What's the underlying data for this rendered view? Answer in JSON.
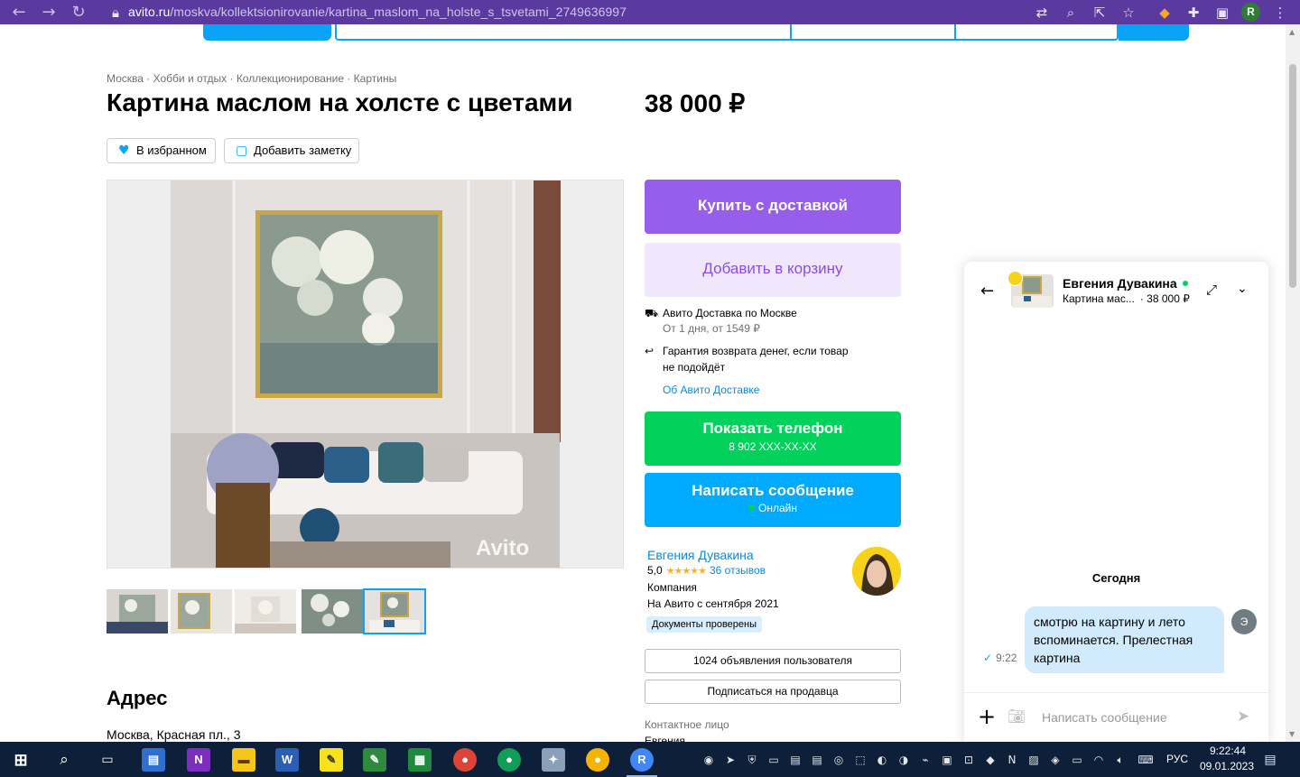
{
  "browser": {
    "url_host": "avito.ru",
    "url_path": "/moskva/kollektsionirovanie/kartina_maslom_na_holste_s_tsvetami_2749636997",
    "profile_initial": "R"
  },
  "breadcrumbs": [
    "Москва",
    "Хобби и отдых",
    "Коллекционирование",
    "Картины"
  ],
  "listing": {
    "title": "Картина маслом на холсте с цветами",
    "price": "38 000 ₽",
    "favorite_label": "В избранном",
    "note_label": "Добавить заметку"
  },
  "actions": {
    "buy_label": "Купить с доставкой",
    "cart_label": "Добавить в корзину",
    "delivery_title": "Авито Доставка по Москве",
    "delivery_sub": "От 1 дня, от 1549 ₽",
    "guarantee_line1": "Гарантия возврата денег, если товар",
    "guarantee_line2": "не подойдёт",
    "delivery_link": "Об Авито Доставке",
    "phone_label": "Показать телефон",
    "phone_number": "8 902 XXX-XX-XX",
    "message_label": "Написать сообщение",
    "online_label": "Онлайн"
  },
  "seller": {
    "name": "Евгения Дувакина",
    "rating": "5,0",
    "stars": "★★★★★",
    "reviews": "36 отзывов",
    "type": "Компания",
    "since": "На Авито с сентября 2021",
    "docs_badge": "Документы проверены",
    "listings_button": "1024 объявления пользователя",
    "subscribe_button": "Подписаться на продавца",
    "contact_heading": "Контактное лицо",
    "contact_name": "Евгения"
  },
  "address": {
    "heading": "Адрес",
    "value": "Москва, Красная пл., 3"
  },
  "watermark": "Avito",
  "chat": {
    "name": "Евгения Дувакина",
    "item_title": "Картина мас...",
    "item_price": "· 38 000 ₽",
    "day_label": "Сегодня",
    "message_text": "смотрю на картину и лето вспоминается. Прелестная картина",
    "message_time": "9:22",
    "sender_initial": "Э",
    "input_placeholder": "Написать сообщение"
  },
  "taskbar": {
    "language": "РУС",
    "time": "9:22:44",
    "date": "09.01.2023"
  },
  "colors": {
    "browser_bar": "#5b3aa0",
    "buy": "#965eeb",
    "cart_bg": "#f0e7fd",
    "phone": "#02d15c",
    "message": "#00aaff",
    "link": "#0a8bd9",
    "bubble": "#d1ebfc",
    "taskbar": "#0d1f39"
  }
}
